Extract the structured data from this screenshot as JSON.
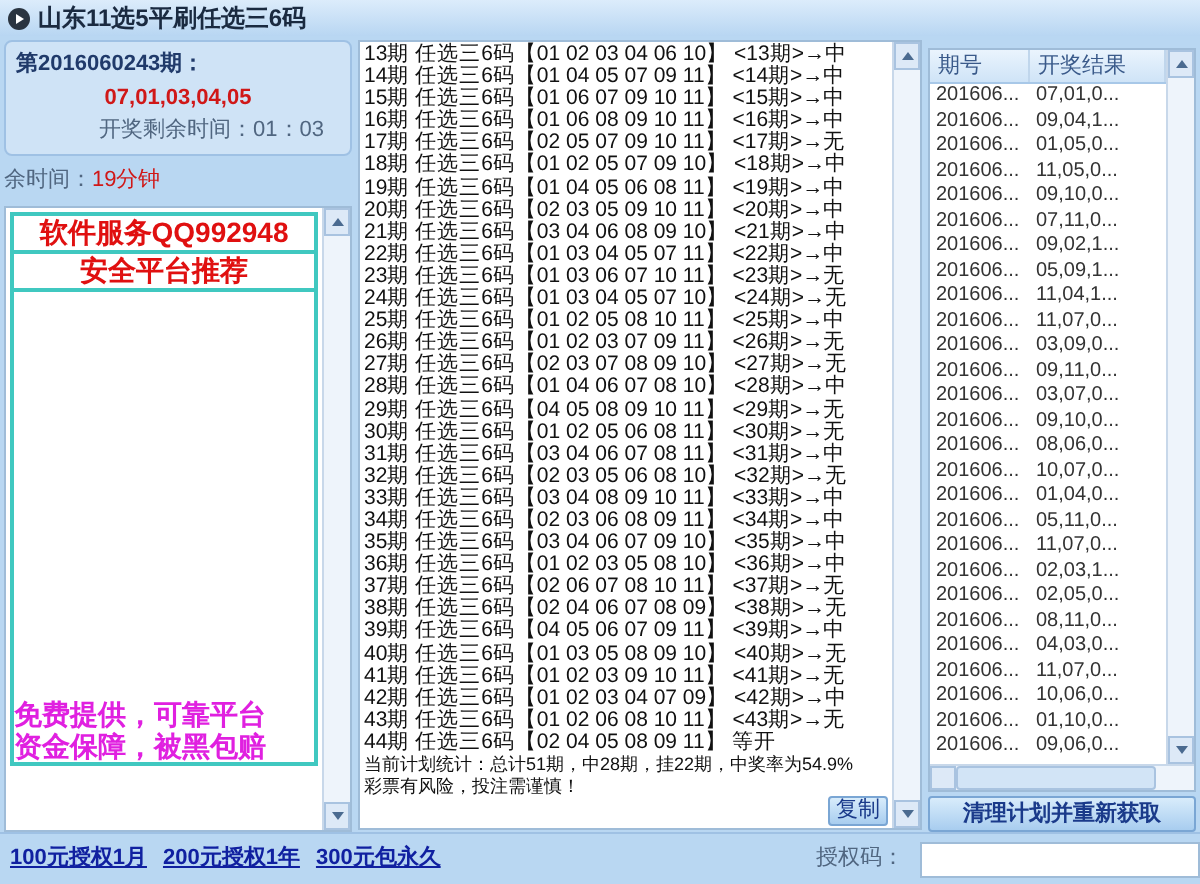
{
  "window": {
    "title": "山东11选5平刷任选三6码"
  },
  "draw_info": {
    "issue": "第2016060243期：",
    "numbers": "07,01,03,04,05",
    "countdown_label": "开奖剩余时间：",
    "countdown": "01：03"
  },
  "remaining": {
    "label": "余时间：",
    "value": "19分钟"
  },
  "ads": [
    {
      "text": "软件服务QQ992948",
      "color": "#e01010"
    },
    {
      "text": "安全平台推荐",
      "color": "#e01010"
    },
    {
      "text": "免费提供，可靠平台",
      "color": "#e020e0"
    },
    {
      "text": "资金保障，被黑包赔",
      "color": "#e020e0"
    }
  ],
  "plan_lines": [
    "13期 任选三6码【01 02 03 04 06 10】 <13期>→中",
    "14期 任选三6码【01 04 05 07 09 11】 <14期>→中",
    "15期 任选三6码【01 06 07 09 10 11】 <15期>→中",
    "16期 任选三6码【01 06 08 09 10 11】 <16期>→中",
    "17期 任选三6码【02 05 07 09 10 11】 <17期>→无",
    "18期 任选三6码【01 02 05 07 09 10】 <18期>→中",
    "19期 任选三6码【01 04 05 06 08 11】 <19期>→中",
    "20期 任选三6码【02 03 05 09 10 11】 <20期>→中",
    "21期 任选三6码【03 04 06 08 09 10】 <21期>→中",
    "22期 任选三6码【01 03 04 05 07 11】 <22期>→中",
    "23期 任选三6码【01 03 06 07 10 11】 <23期>→无",
    "24期 任选三6码【01 03 04 05 07 10】 <24期>→无",
    "25期 任选三6码【01 02 05 08 10 11】 <25期>→中",
    "26期 任选三6码【01 02 03 07 09 11】 <26期>→无",
    "27期 任选三6码【02 03 07 08 09 10】 <27期>→无",
    "28期 任选三6码【01 04 06 07 08 10】 <28期>→中",
    "29期 任选三6码【04 05 08 09 10 11】 <29期>→无",
    "30期 任选三6码【01 02 05 06 08 11】 <30期>→无",
    "31期 任选三6码【03 04 06 07 08 11】 <31期>→中",
    "32期 任选三6码【02 03 05 06 08 10】 <32期>→无",
    "33期 任选三6码【03 04 08 09 10 11】 <33期>→中",
    "34期 任选三6码【02 03 06 08 09 11】 <34期>→中",
    "35期 任选三6码【03 04 06 07 09 10】 <35期>→中",
    "36期 任选三6码【01 02 03 05 08 10】 <36期>→中",
    "37期 任选三6码【02 06 07 08 10 11】 <37期>→无",
    "38期 任选三6码【02 04 06 07 08 09】 <38期>→无",
    "39期 任选三6码【04 05 06 07 09 11】 <39期>→中",
    "40期 任选三6码【01 03 05 08 09 10】 <40期>→无",
    "41期 任选三6码【01 02 03 09 10 11】 <41期>→无",
    "42期 任选三6码【01 02 03 04 07 09】 <42期>→中",
    "43期 任选三6码【01 02 06 08 10 11】 <43期>→无",
    "44期 任选三6码【02 04 05 08 09 11】 等开"
  ],
  "stats": [
    "当前计划统计：总计51期，中28期，挂22期，中奖率为54.9%",
    "彩票有风险，投注需谨慎！"
  ],
  "copy_button": "复制",
  "results_table": {
    "columns": [
      "期号",
      "开奖结果"
    ],
    "rows": [
      [
        "201606...",
        "07,01,0..."
      ],
      [
        "201606...",
        "09,04,1..."
      ],
      [
        "201606...",
        "01,05,0..."
      ],
      [
        "201606...",
        "11,05,0..."
      ],
      [
        "201606...",
        "09,10,0..."
      ],
      [
        "201606...",
        "07,11,0..."
      ],
      [
        "201606...",
        "09,02,1..."
      ],
      [
        "201606...",
        "05,09,1..."
      ],
      [
        "201606...",
        "11,04,1..."
      ],
      [
        "201606...",
        "11,07,0..."
      ],
      [
        "201606...",
        "03,09,0..."
      ],
      [
        "201606...",
        "09,11,0..."
      ],
      [
        "201606...",
        "03,07,0..."
      ],
      [
        "201606...",
        "09,10,0..."
      ],
      [
        "201606...",
        "08,06,0..."
      ],
      [
        "201606...",
        "10,07,0..."
      ],
      [
        "201606...",
        "01,04,0..."
      ],
      [
        "201606...",
        "05,11,0..."
      ],
      [
        "201606...",
        "11,07,0..."
      ],
      [
        "201606...",
        "02,03,1..."
      ],
      [
        "201606...",
        "02,05,0..."
      ],
      [
        "201606...",
        "08,11,0..."
      ],
      [
        "201606...",
        "04,03,0..."
      ],
      [
        "201606...",
        "11,07,0..."
      ],
      [
        "201606...",
        "10,06,0..."
      ],
      [
        "201606...",
        "01,10,0..."
      ],
      [
        "201606...",
        "09,06,0..."
      ]
    ]
  },
  "refresh_button": "清理计划并重新获取",
  "license_links": [
    "100元授权1月",
    "200元授权1年",
    "300元包永久"
  ],
  "license_code": {
    "label": "授权码："
  }
}
